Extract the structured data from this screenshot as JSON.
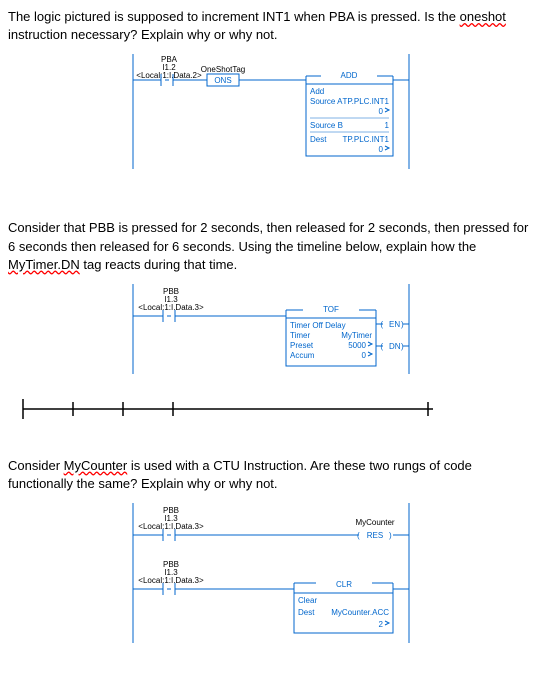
{
  "q1": {
    "text_pre": "The logic pictured is supposed to increment INT1 when PBA is pressed. Is the ",
    "text_u": "oneshot",
    "text_post": " instruction necessary? Explain why or why not.",
    "contact_name": "PBA",
    "contact_addr": "I1.2",
    "contact_tag": "<Local:1:I.Data.2>",
    "ons_name": "OneShotTag",
    "ons_label": "ONS",
    "add": {
      "title": "ADD",
      "l1": "Add",
      "l2a": "Source A",
      "l2b": "TP.PLC.INT1",
      "l2c": "0",
      "l3a": "Source B",
      "l3b": "1",
      "l4a": "Dest",
      "l4b": "TP.PLC.INT1",
      "l4c": "0"
    }
  },
  "q2": {
    "text_pre": "Consider that PBB is pressed for 2 seconds, then released for 2 seconds, then pressed for 6 seconds then released for 6 seconds. Using the timeline below, explain how the ",
    "text_u": "MyTimer.DN",
    "text_post": " tag reacts during that time.",
    "contact_name": "PBB",
    "contact_addr": "I1.3",
    "contact_tag": "<Local:1:I.Data.3>",
    "tof": {
      "title": "TOF",
      "l1": "Timer Off Delay",
      "l2a": "Timer",
      "l2b": "MyTimer",
      "l3a": "Preset",
      "l3b": "5000",
      "l4a": "Accum",
      "l4b": "0",
      "en": "EN",
      "dn": "DN"
    }
  },
  "q3": {
    "text_pre": "Consider ",
    "text_u": "MyCounter",
    "text_post": " is used with a CTU Instruction. Are these two rungs of code functionally the same? Explain why or why not.",
    "contact_name": "PBB",
    "contact_addr": "I1.3",
    "contact_tag": "<Local:1:I.Data.3>",
    "res": {
      "name": "MyCounter",
      "label": "RES"
    },
    "clr": {
      "title": "CLR",
      "l1": "Clear",
      "l2a": "Dest",
      "l2b": "MyCounter.ACC",
      "l2c": "2"
    }
  }
}
